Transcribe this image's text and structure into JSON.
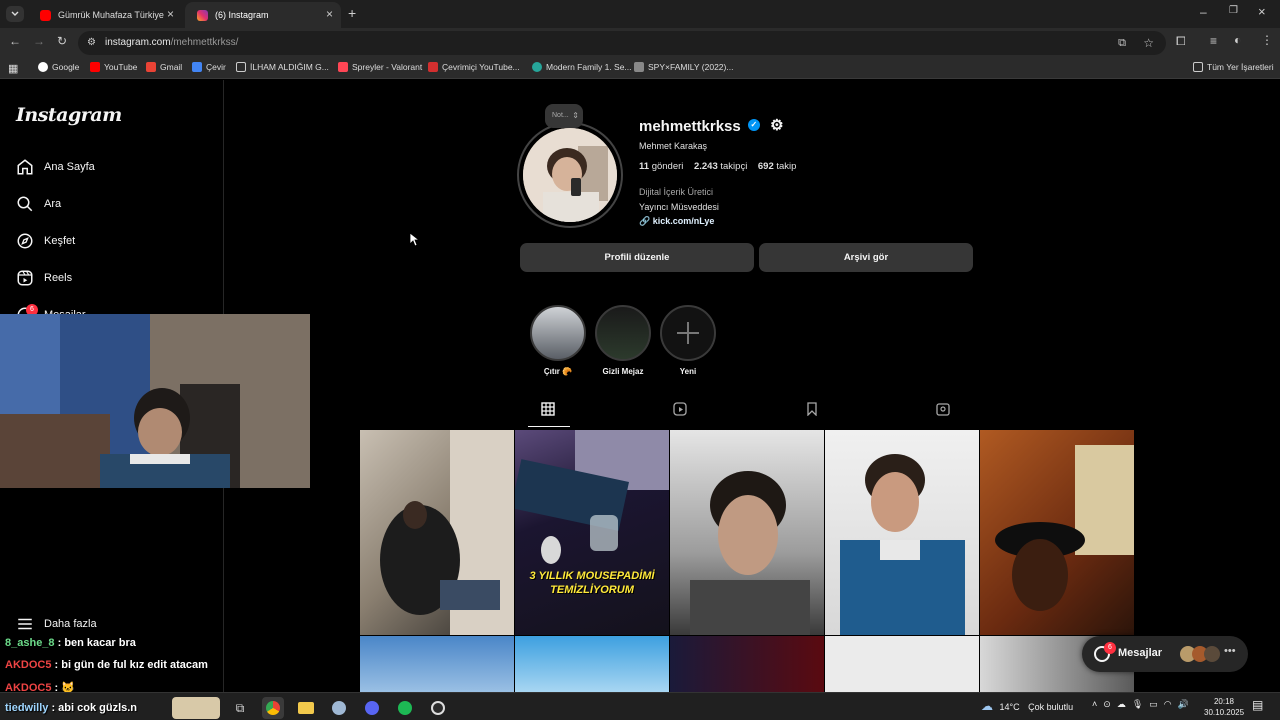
{
  "browser": {
    "tabs": [
      {
        "title": "Gümrük Muhafaza Türkiye 15. E",
        "active": false
      },
      {
        "title": "(6) Instagram",
        "active": true
      }
    ],
    "url_host": "instagram.com",
    "url_path": "/mehmettkrkss/",
    "bookmarks": [
      {
        "label": "Google",
        "icon": "google-icon"
      },
      {
        "label": "YouTube",
        "icon": "youtube-icon"
      },
      {
        "label": "Gmail",
        "icon": "gmail-icon"
      },
      {
        "label": "Çevir",
        "icon": "translate-icon"
      },
      {
        "label": "İLHAM ALDIĞIM G...",
        "icon": "folder-icon"
      },
      {
        "label": "Spreyler - Valorant",
        "icon": "valorant-icon"
      },
      {
        "label": "Çevrimiçi YouTube...",
        "icon": "bookmark-icon"
      },
      {
        "label": "Modern Family 1. Se...",
        "icon": "bookmark-icon"
      },
      {
        "label": "SPY×FAMILY (2022)...",
        "icon": "bookmark-icon"
      }
    ],
    "all_bookmarks": "Tüm Yer İşaretleri"
  },
  "sidebar": {
    "logo": "Instagram",
    "items": [
      {
        "label": "Ana Sayfa",
        "icon": "home-icon"
      },
      {
        "label": "Ara",
        "icon": "search-icon"
      },
      {
        "label": "Keşfet",
        "icon": "compass-icon"
      },
      {
        "label": "Reels",
        "icon": "reels-icon"
      },
      {
        "label": "Mesajlar",
        "icon": "messenger-icon",
        "badge": "6"
      }
    ],
    "more": "Daha fazla"
  },
  "profile": {
    "note": "Not...",
    "username": "mehmettkrkss",
    "full_name": "Mehmet Karakaş",
    "posts_count": "11",
    "posts_label": "gönderi",
    "followers_count": "2.243",
    "followers_label": "takipçi",
    "following_count": "692",
    "following_label": "takip",
    "category": "Dijital İçerik Üretici",
    "bio": "Yayıncı Müsveddesi",
    "link": "kick.com/nLye",
    "edit_button": "Profili düzenle",
    "archive_button": "Arşivi gör"
  },
  "highlights": [
    {
      "label": "Çıtır 🥐"
    },
    {
      "label": "Gizli Mejaz"
    },
    {
      "label": "Yeni"
    }
  ],
  "posts": [
    {
      "caption": ""
    },
    {
      "caption": "3 YILLIK MOUSEPADİMİ TEMİZLİYORUM"
    },
    {
      "caption": ""
    },
    {
      "caption": ""
    },
    {
      "caption": ""
    }
  ],
  "messages_pill": {
    "label": "Mesajlar",
    "badge": "6"
  },
  "chat": [
    {
      "user": "8_ashe_8",
      "text": " : ben kacar bra"
    },
    {
      "user": "AKDOC5",
      "text": " : bi gün de ful kız edit atacam"
    },
    {
      "user": "AKDOC5",
      "text": " : 🐱"
    },
    {
      "user": "tiedwilly",
      "text": " : abi cok güzls.n"
    }
  ],
  "taskbar": {
    "weather": "14°C",
    "weather_text": "Çok bulutlu",
    "time": "20:18",
    "date": "30.10.2025"
  },
  "colors": {
    "verified": "#0095f6",
    "link": "#e0f1ff",
    "badge": "#ff3040"
  }
}
